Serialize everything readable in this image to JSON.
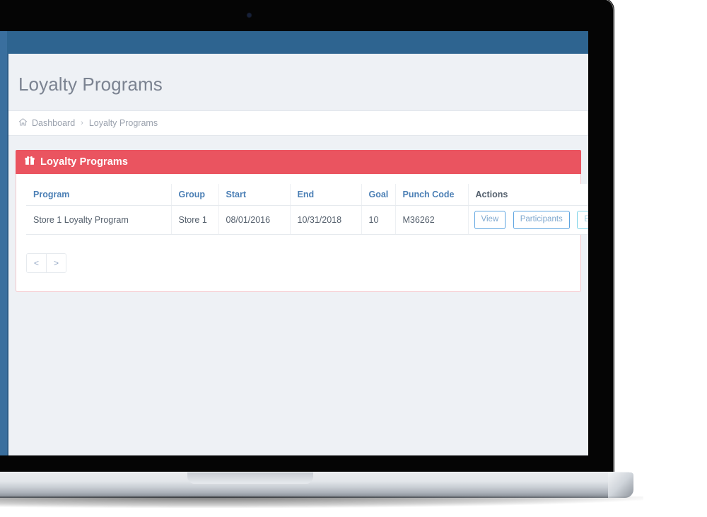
{
  "device": {
    "type": "laptop-mockup",
    "webcam_icon": "webcam-dot"
  },
  "app": {
    "navbar_color": "#2e6490",
    "sidebar_color": "#3a6f9e",
    "accent_color": "#ea5460",
    "link_color": "#4b7fb5",
    "body_background": "#eef1f5"
  },
  "page": {
    "title": "Loyalty Programs"
  },
  "breadcrumb": {
    "home_icon": "home-icon",
    "separator": "›",
    "items": [
      {
        "label": "Dashboard"
      },
      {
        "label": "Loyalty Programs"
      }
    ]
  },
  "panel": {
    "icon": "gift-icon",
    "title": "Loyalty Programs",
    "header_color": "#ea5460",
    "border_color": "#f3c6cb"
  },
  "table": {
    "columns": [
      {
        "key": "program",
        "label": "Program",
        "style": "link"
      },
      {
        "key": "group",
        "label": "Group",
        "style": "link"
      },
      {
        "key": "start",
        "label": "Start",
        "style": "link"
      },
      {
        "key": "end",
        "label": "End",
        "style": "link"
      },
      {
        "key": "goal",
        "label": "Goal",
        "style": "link"
      },
      {
        "key": "punch_code",
        "label": "Punch Code",
        "style": "link"
      },
      {
        "key": "actions",
        "label": "Actions",
        "style": "plain"
      }
    ],
    "rows": [
      {
        "program": "Store 1 Loyalty Program",
        "group": "Store 1",
        "start": "08/01/2016",
        "end": "10/31/2018",
        "goal": "10",
        "punch_code": "M36262",
        "actions": [
          {
            "label": "View",
            "variant": "primary"
          },
          {
            "label": "Participants",
            "variant": "primary"
          },
          {
            "label": "Edit",
            "variant": "info"
          }
        ]
      }
    ]
  },
  "pagination": {
    "prev_label": "<",
    "next_label": ">"
  }
}
